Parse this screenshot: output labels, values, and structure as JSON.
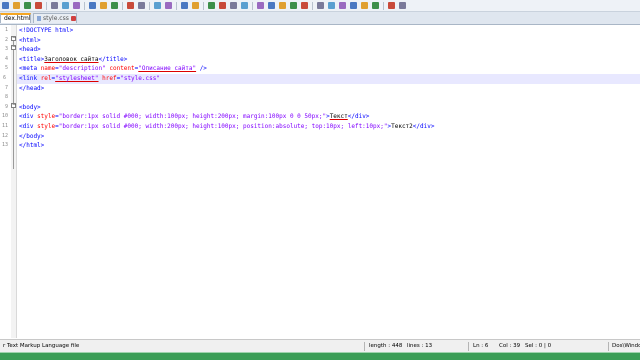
{
  "colors": {
    "tag": "#0000ff",
    "attribute": "#ff0000",
    "attr_value": "#8000ff",
    "text": "#000000",
    "current_line": "#e8e8ff",
    "active_tab_accent": "#f5a623",
    "bottom_strip": "#3a9d56"
  },
  "tabs": [
    {
      "label": "dex.html",
      "active": true
    },
    {
      "label": "style.css",
      "active": false
    }
  ],
  "toolbar_icons": [
    "new-file-icon",
    "open-file-icon",
    "save-icon",
    "save-all-icon",
    "close-icon",
    "close-all-icon",
    "print-icon",
    "cut-icon",
    "copy-icon",
    "paste-icon",
    "undo-icon",
    "redo-icon",
    "find-icon",
    "replace-icon",
    "zoom-in-icon",
    "zoom-out-icon",
    "sync-v-icon",
    "sync-h-icon",
    "word-wrap-icon",
    "all-chars-icon",
    "indent-guide-icon",
    "udl-icon",
    "doc-map-icon",
    "function-list-icon",
    "folder-workspace-icon",
    "monitor-icon",
    "record-macro-icon",
    "stop-macro-icon",
    "play-macro-icon",
    "run-macro-multiple-icon",
    "save-macro-icon",
    "spell-check-icon",
    "abc-icon"
  ],
  "editor": {
    "line_numbers": [
      "1",
      "2",
      "3",
      "4",
      "5",
      "6",
      "7",
      "8",
      "9",
      "10",
      "11",
      "12",
      "13"
    ],
    "lines": [
      [
        {
          "c": "tag",
          "t": "<!DOCTYPE html>"
        }
      ],
      [
        {
          "c": "tag",
          "t": "<html>"
        }
      ],
      [
        {
          "c": "tag",
          "t": "<head>"
        }
      ],
      [
        {
          "c": "tag",
          "t": "<title>"
        },
        {
          "c": "txt ru",
          "t": "Заголовок сайта"
        },
        {
          "c": "tag",
          "t": "</title>"
        }
      ],
      [
        {
          "c": "tag",
          "t": "<meta "
        },
        {
          "c": "attr",
          "t": "name"
        },
        {
          "c": "tag",
          "t": "="
        },
        {
          "c": "val",
          "t": "\"description\""
        },
        {
          "c": "tag",
          "t": " "
        },
        {
          "c": "attr",
          "t": "content"
        },
        {
          "c": "tag",
          "t": "="
        },
        {
          "c": "val ru",
          "t": "\"Описание сайта\""
        },
        {
          "c": "tag",
          "t": " />"
        }
      ],
      [
        {
          "c": "tag",
          "t": "<link "
        },
        {
          "c": "attr",
          "t": "rel"
        },
        {
          "c": "tag",
          "t": "="
        },
        {
          "c": "val ru",
          "t": "\"stylesheet\""
        },
        {
          "c": "tag",
          "t": " "
        },
        {
          "c": "attr",
          "t": "href"
        },
        {
          "c": "tag",
          "t": "="
        },
        {
          "c": "val",
          "t": "\"style.css\""
        }
      ],
      [
        {
          "c": "tag",
          "t": "</head>"
        }
      ],
      [
        {
          "c": "txt",
          "t": ""
        }
      ],
      [
        {
          "c": "tag",
          "t": "<body>"
        }
      ],
      [
        {
          "c": "tag",
          "t": "<div "
        },
        {
          "c": "attr",
          "t": "style"
        },
        {
          "c": "tag",
          "t": "="
        },
        {
          "c": "val",
          "t": "\"border:1px solid #000; width:100px; height:200px; margin:100px 0 0 50px;\""
        },
        {
          "c": "tag",
          "t": ">"
        },
        {
          "c": "txt ru",
          "t": "Текст"
        },
        {
          "c": "tag",
          "t": "</div>"
        }
      ],
      [
        {
          "c": "tag",
          "t": "<div "
        },
        {
          "c": "attr",
          "t": "style"
        },
        {
          "c": "tag",
          "t": "="
        },
        {
          "c": "val",
          "t": "\"border:1px solid #000; width:200px; height:100px; position:absolute; top:10px; left:10px;\""
        },
        {
          "c": "tag",
          "t": ">"
        },
        {
          "c": "txt",
          "t": "Текст2"
        },
        {
          "c": "tag",
          "t": "</div>"
        }
      ],
      [
        {
          "c": "tag",
          "t": "</body>"
        }
      ],
      [
        {
          "c": "tag",
          "t": "</html>"
        }
      ]
    ]
  },
  "statusbar": {
    "file_type": "r Text Markup Language file",
    "length": "length : 448",
    "lines": "lines : 13",
    "position": "Ln : 6",
    "column": "Col : 39",
    "selection": "Sel : 0 | 0",
    "eol": "Dos\\Windo"
  }
}
